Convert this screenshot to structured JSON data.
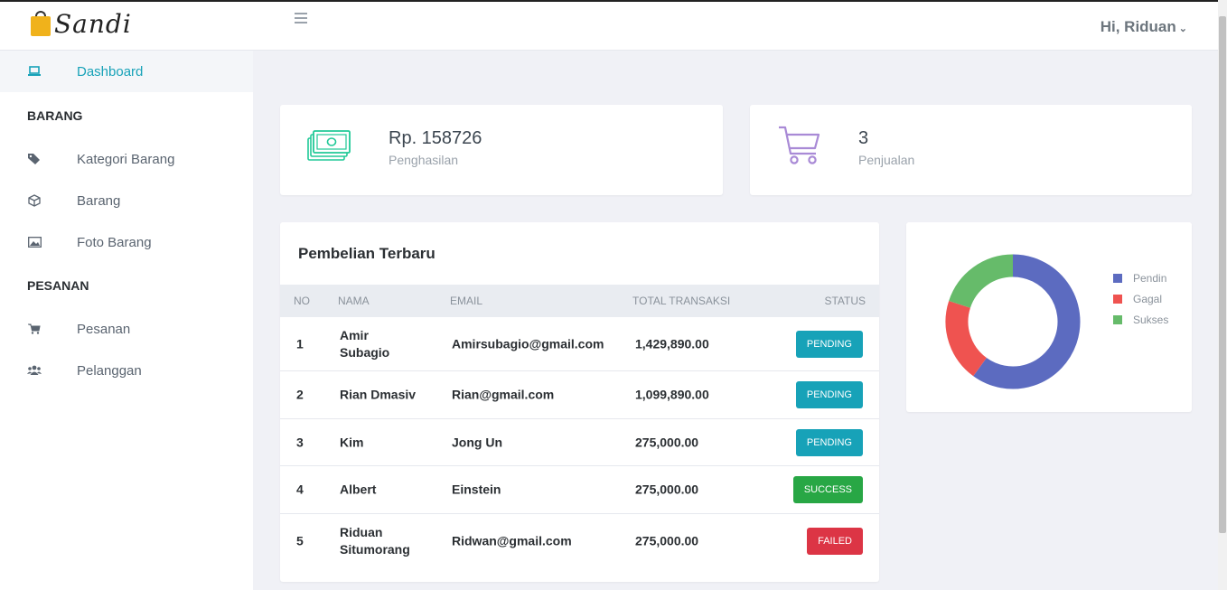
{
  "app": {
    "brand": "Sandi",
    "user_greeting": "Hi, Riduan"
  },
  "sidebar": {
    "dashboard": "Dashboard",
    "section_barang": "BARANG",
    "kategori": "Kategori Barang",
    "barang": "Barang",
    "foto": "Foto Barang",
    "section_pesanan": "PESANAN",
    "pesanan": "Pesanan",
    "pelanggan": "Pelanggan"
  },
  "stats": {
    "income": {
      "value": "Rp. 158726",
      "label": "Penghasilan"
    },
    "sales": {
      "value": "3",
      "label": "Penjualan"
    }
  },
  "table": {
    "title": "Pembelian Terbaru",
    "headers": {
      "no": "NO",
      "nama": "NAMA",
      "email": "EMAIL",
      "total": "TOTAL TRANSAKSI",
      "status": "STATUS"
    },
    "rows": [
      {
        "no": "1",
        "nama": "Amir Subagio",
        "email": "Amirsubagio@gmail.com",
        "total": "1,429,890.00",
        "status": "PENDING"
      },
      {
        "no": "2",
        "nama": "Rian Dmasiv",
        "email": "Rian@gmail.com",
        "total": "1,099,890.00",
        "status": "PENDING"
      },
      {
        "no": "3",
        "nama": "Kim",
        "email": "Jong Un",
        "total": "275,000.00",
        "status": "PENDING"
      },
      {
        "no": "4",
        "nama": "Albert",
        "email": "Einstein",
        "total": "275,000.00",
        "status": "SUCCESS"
      },
      {
        "no": "5",
        "nama": "Riduan Situmorang",
        "email": "Ridwan@gmail.com",
        "total": "275,000.00",
        "status": "FAILED"
      }
    ]
  },
  "colors": {
    "accent": "#17a2b8",
    "pending": "#17a2b8",
    "success": "#28a745",
    "failed": "#dc3545",
    "income_icon": "#20c997",
    "sales_icon": "#a98ad6"
  },
  "icons": {
    "dashboard": "laptop-icon",
    "kategori": "tags-icon",
    "barang": "cube-icon",
    "foto": "image-icon",
    "pesanan": "cart-icon",
    "pelanggan": "users-icon"
  },
  "chart_data": {
    "type": "pie",
    "labels": [
      "Pendin",
      "Gagal",
      "Sukses"
    ],
    "values": [
      3,
      1,
      1
    ],
    "colors": [
      "#5c6bc0",
      "#ef5350",
      "#66bb6a"
    ],
    "legend": "right",
    "donut": true
  }
}
